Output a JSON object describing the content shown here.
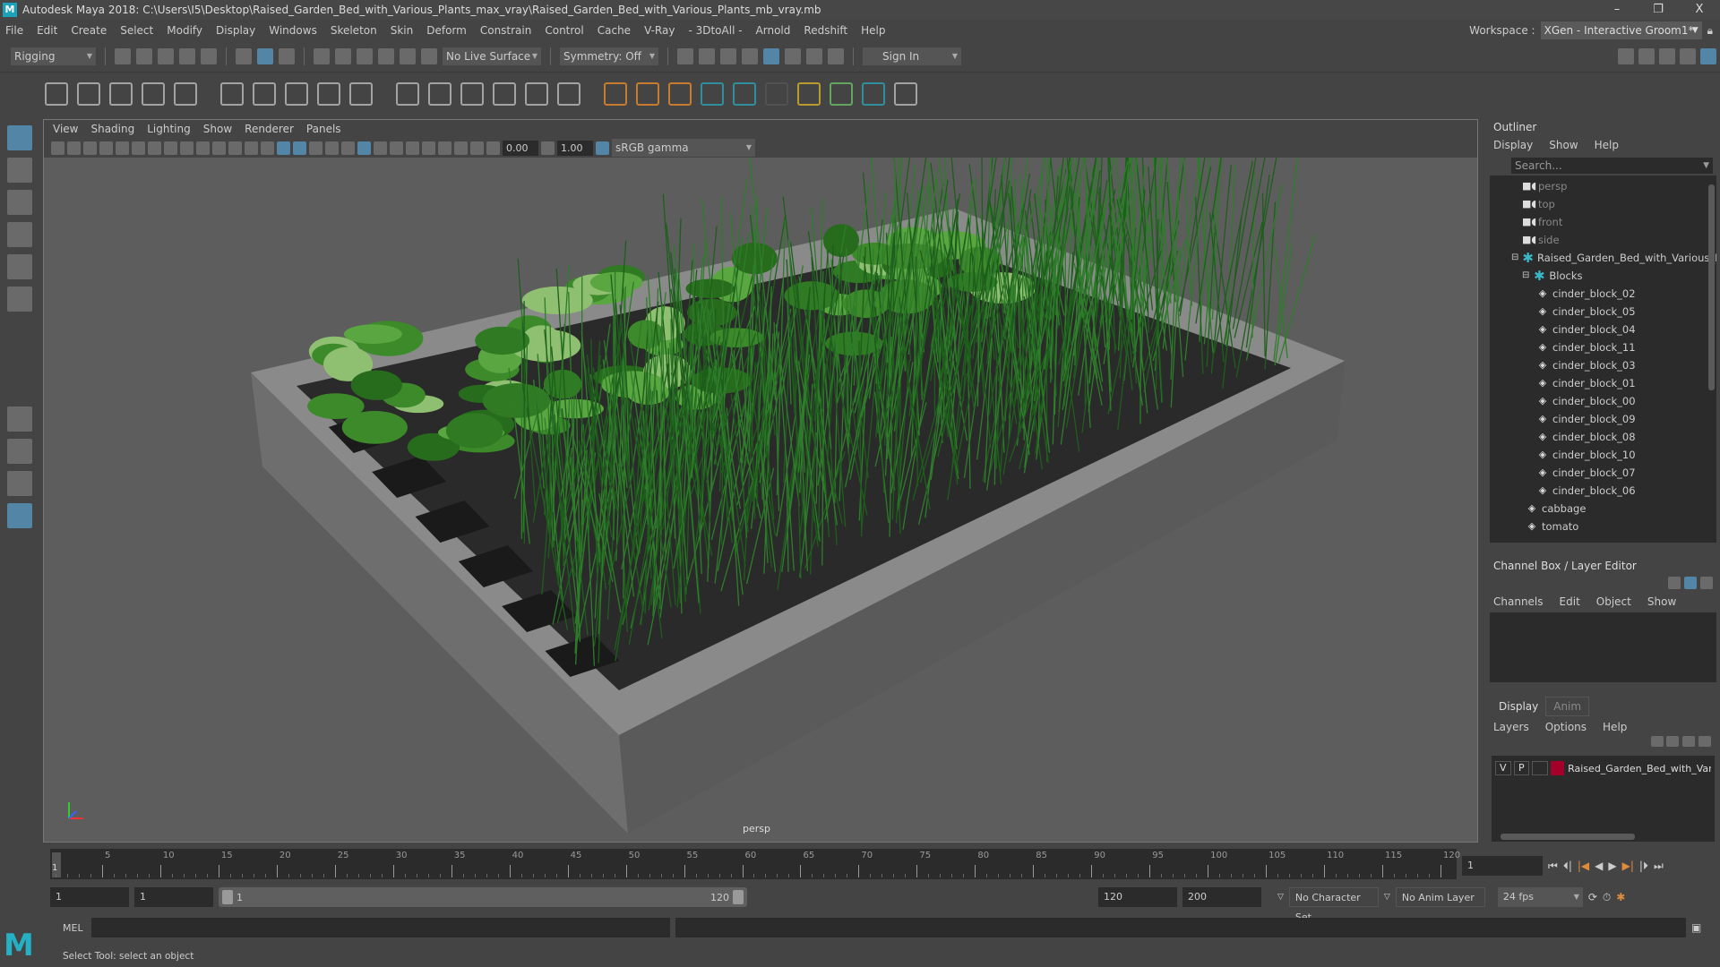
{
  "title": "Autodesk Maya 2018: C:\\Users\\I5\\Desktop\\Raised_Garden_Bed_with_Various_Plants_max_vray\\Raised_Garden_Bed_with_Various_Plants_mb_vray.mb",
  "window_buttons": [
    "–",
    "❐",
    "X"
  ],
  "menu": [
    "File",
    "Edit",
    "Create",
    "Select",
    "Modify",
    "Display",
    "Windows",
    "Skeleton",
    "Skin",
    "Deform",
    "Constrain",
    "Control",
    "Cache",
    "V-Ray",
    "- 3DtoAll -",
    "Arnold",
    "Redshift",
    "Help"
  ],
  "workspace": {
    "label": "Workspace :",
    "value": "XGen - Interactive Groom1*"
  },
  "status_line": {
    "mode": "Rigging",
    "live_surface": "No Live Surface",
    "symmetry": "Symmetry: Off",
    "sign_in": "Sign In"
  },
  "viewport": {
    "menu": [
      "View",
      "Shading",
      "Lighting",
      "Show",
      "Renderer",
      "Panels"
    ],
    "exposure": "0.00",
    "gamma": "1.00",
    "color_space": "sRGB gamma",
    "camera": "persp"
  },
  "outliner": {
    "title": "Outliner",
    "menu": [
      "Display",
      "Show",
      "Help"
    ],
    "search_placeholder": "Search...",
    "items": [
      {
        "label": "persp",
        "type": "camera",
        "depth": 0
      },
      {
        "label": "top",
        "type": "camera",
        "depth": 0
      },
      {
        "label": "front",
        "type": "camera",
        "depth": 0
      },
      {
        "label": "side",
        "type": "camera",
        "depth": 0
      },
      {
        "label": "Raised_Garden_Bed_with_Various_Pla",
        "type": "set",
        "depth": 0,
        "expanded": true
      },
      {
        "label": "Blocks",
        "type": "set",
        "depth": 1,
        "expanded": true
      },
      {
        "label": "cinder_block_02",
        "type": "mesh",
        "depth": 2
      },
      {
        "label": "cinder_block_05",
        "type": "mesh",
        "depth": 2
      },
      {
        "label": "cinder_block_04",
        "type": "mesh",
        "depth": 2
      },
      {
        "label": "cinder_block_11",
        "type": "mesh",
        "depth": 2
      },
      {
        "label": "cinder_block_03",
        "type": "mesh",
        "depth": 2
      },
      {
        "label": "cinder_block_01",
        "type": "mesh",
        "depth": 2
      },
      {
        "label": "cinder_block_00",
        "type": "mesh",
        "depth": 2
      },
      {
        "label": "cinder_block_09",
        "type": "mesh",
        "depth": 2
      },
      {
        "label": "cinder_block_08",
        "type": "mesh",
        "depth": 2
      },
      {
        "label": "cinder_block_10",
        "type": "mesh",
        "depth": 2
      },
      {
        "label": "cinder_block_07",
        "type": "mesh",
        "depth": 2
      },
      {
        "label": "cinder_block_06",
        "type": "mesh",
        "depth": 2
      },
      {
        "label": "cabbage",
        "type": "mesh",
        "depth": 1
      },
      {
        "label": "tomato",
        "type": "mesh",
        "depth": 1
      }
    ]
  },
  "channel_box": {
    "title": "Channel Box / Layer Editor",
    "menu": [
      "Channels",
      "Edit",
      "Object",
      "Show"
    ]
  },
  "layer_editor": {
    "tabs": [
      "Display",
      "Anim"
    ],
    "active_tab": "Display",
    "menu": [
      "Layers",
      "Options",
      "Help"
    ],
    "layers": [
      {
        "visible": "V",
        "playback": "P",
        "name": "Raised_Garden_Bed_with_Vari",
        "color": "#a3002a"
      }
    ]
  },
  "timeline": {
    "ticks": [
      "5",
      "10",
      "15",
      "20",
      "25",
      "30",
      "35",
      "40",
      "45",
      "50",
      "55",
      "60",
      "65",
      "70",
      "75",
      "80",
      "85",
      "90",
      "95",
      "100",
      "105",
      "110",
      "115",
      "120"
    ],
    "current_frame": "1",
    "start": 1,
    "end": 120
  },
  "range": {
    "start": "1",
    "anim_start": "1",
    "slider_start": "1",
    "slider_end": "120",
    "end": "120",
    "anim_end": "200",
    "character_set": "No Character Set",
    "anim_layer": "No Anim Layer",
    "fps": "24 fps"
  },
  "command_line": {
    "language": "MEL"
  },
  "status_message": "Select Tool: select an object",
  "colors": {
    "accent": "#5285a6",
    "maya_teal": "#26b0c4",
    "layer_color": "#a3002a"
  }
}
